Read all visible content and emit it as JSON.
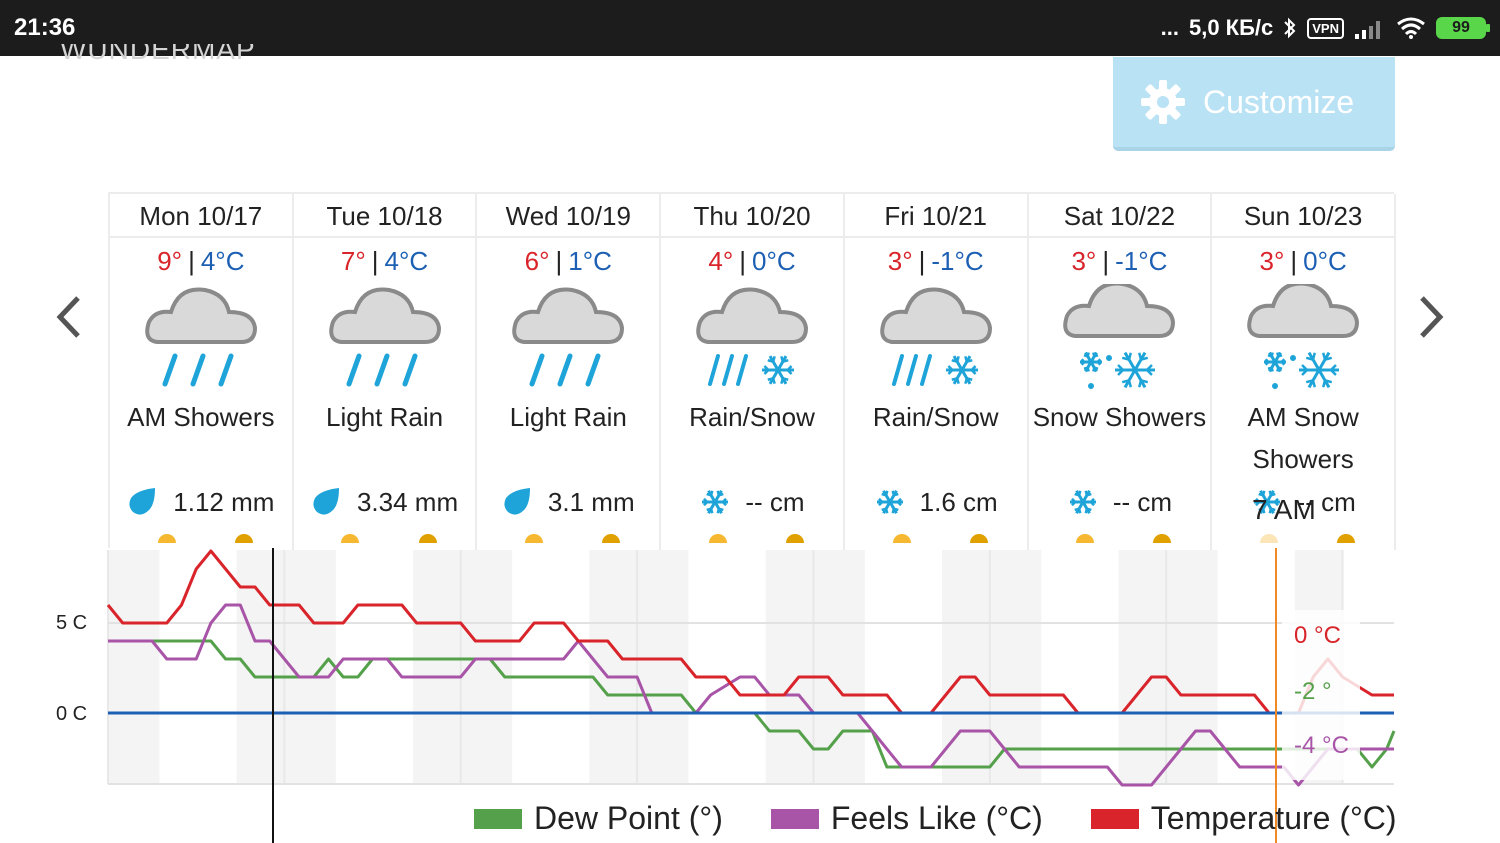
{
  "status_bar": {
    "time": "21:36",
    "dots": "...",
    "speed": "5,0 КБ/с",
    "vpn": "VPN",
    "battery": "99"
  },
  "header": {
    "wundermap": "WUNDERMAP",
    "customize_label": "Customize"
  },
  "days": [
    {
      "date": "Mon 10/17",
      "hi": "9°",
      "lo": "4°C",
      "icon": "rain-icon",
      "condition": "AM Showers",
      "precip_icon": "raindrop-icon",
      "precip": "1.12 mm"
    },
    {
      "date": "Tue 10/18",
      "hi": "7°",
      "lo": "4°C",
      "icon": "rain-icon",
      "condition": "Light Rain",
      "precip_icon": "raindrop-icon",
      "precip": "3.34 mm"
    },
    {
      "date": "Wed 10/19",
      "hi": "6°",
      "lo": "1°C",
      "icon": "rain-icon",
      "condition": "Light Rain",
      "precip_icon": "raindrop-icon",
      "precip": "3.1 mm"
    },
    {
      "date": "Thu 10/20",
      "hi": "4°",
      "lo": "0°C",
      "icon": "rain-snow-icon",
      "condition": "Rain/Snow",
      "precip_icon": "snowflake-icon",
      "precip": "-- cm"
    },
    {
      "date": "Fri 10/21",
      "hi": "3°",
      "lo": "-1°C",
      "icon": "rain-snow-icon",
      "condition": "Rain/Snow",
      "precip_icon": "snowflake-icon",
      "precip": "1.6 cm"
    },
    {
      "date": "Sat 10/22",
      "hi": "3°",
      "lo": "-1°C",
      "icon": "snow-showers-icon",
      "condition": "Snow Showers",
      "precip_icon": "snowflake-icon",
      "precip": "-- cm"
    },
    {
      "date": "Sun 10/23",
      "hi": "3°",
      "lo": "0°C",
      "icon": "snow-showers-icon",
      "condition": "AM Snow Showers",
      "precip_icon": "snowflake-icon",
      "precip": "-- cm"
    }
  ],
  "cursor_time": "7 AM",
  "colors": {
    "temperature": "#d8242a",
    "feels_like": "#a855a8",
    "dew_point": "#55a04a",
    "freezing_line": "#1c5fb3",
    "sunrise": "#f5b830",
    "sunset": "#e0a000"
  },
  "chart_data": {
    "type": "line",
    "y_ticks": [
      "5 C",
      "0 C"
    ],
    "ylim": [
      -4,
      9
    ],
    "x_range_hours": [
      0,
      168
    ],
    "tooltip": {
      "temperature": "0 °C",
      "dew_point": "-2 °",
      "feels_like": "-4 °C"
    },
    "series": [
      {
        "name": "Temperature (°C)",
        "points": [
          [
            0,
            6
          ],
          [
            2,
            5
          ],
          [
            8,
            5
          ],
          [
            10,
            6
          ],
          [
            12,
            8
          ],
          [
            14,
            9
          ],
          [
            16,
            8
          ],
          [
            18,
            7
          ],
          [
            20,
            7
          ],
          [
            22,
            6
          ],
          [
            26,
            6
          ],
          [
            28,
            5
          ],
          [
            32,
            5
          ],
          [
            34,
            6
          ],
          [
            40,
            6
          ],
          [
            42,
            5
          ],
          [
            48,
            5
          ],
          [
            50,
            4
          ],
          [
            56,
            4
          ],
          [
            58,
            5
          ],
          [
            62,
            5
          ],
          [
            64,
            4
          ],
          [
            68,
            4
          ],
          [
            70,
            3
          ],
          [
            78,
            3
          ],
          [
            80,
            2
          ],
          [
            84,
            2
          ],
          [
            86,
            1
          ],
          [
            92,
            1
          ],
          [
            94,
            2
          ],
          [
            98,
            2
          ],
          [
            100,
            1
          ],
          [
            106,
            1
          ],
          [
            108,
            0
          ],
          [
            112,
            0
          ],
          [
            114,
            1
          ],
          [
            116,
            2
          ],
          [
            118,
            2
          ],
          [
            120,
            1
          ],
          [
            130,
            1
          ],
          [
            132,
            0
          ],
          [
            138,
            0
          ],
          [
            140,
            1
          ],
          [
            142,
            2
          ],
          [
            144,
            2
          ],
          [
            146,
            1
          ],
          [
            156,
            1
          ],
          [
            158,
            0
          ],
          [
            162,
            0
          ],
          [
            164,
            2
          ],
          [
            166,
            3
          ],
          [
            168,
            2
          ],
          [
            172,
            1
          ],
          [
            175,
            1
          ]
        ]
      },
      {
        "name": "Feels Like (°C)",
        "points": [
          [
            0,
            4
          ],
          [
            6,
            4
          ],
          [
            8,
            3
          ],
          [
            12,
            3
          ],
          [
            14,
            5
          ],
          [
            16,
            6
          ],
          [
            18,
            6
          ],
          [
            20,
            4
          ],
          [
            22,
            4
          ],
          [
            24,
            3
          ],
          [
            26,
            2
          ],
          [
            30,
            2
          ],
          [
            32,
            3
          ],
          [
            38,
            3
          ],
          [
            40,
            2
          ],
          [
            48,
            2
          ],
          [
            50,
            3
          ],
          [
            62,
            3
          ],
          [
            64,
            4
          ],
          [
            66,
            3
          ],
          [
            68,
            2
          ],
          [
            72,
            2
          ],
          [
            74,
            0
          ],
          [
            80,
            0
          ],
          [
            82,
            1
          ],
          [
            86,
            2
          ],
          [
            88,
            2
          ],
          [
            90,
            1
          ],
          [
            94,
            1
          ],
          [
            96,
            0
          ],
          [
            102,
            0
          ],
          [
            104,
            -1
          ],
          [
            106,
            -2
          ],
          [
            108,
            -3
          ],
          [
            112,
            -3
          ],
          [
            114,
            -2
          ],
          [
            116,
            -1
          ],
          [
            120,
            -1
          ],
          [
            122,
            -2
          ],
          [
            124,
            -3
          ],
          [
            136,
            -3
          ],
          [
            138,
            -4
          ],
          [
            142,
            -4
          ],
          [
            144,
            -3
          ],
          [
            146,
            -2
          ],
          [
            148,
            -1
          ],
          [
            150,
            -1
          ],
          [
            152,
            -2
          ],
          [
            154,
            -3
          ],
          [
            160,
            -3
          ],
          [
            162,
            -4
          ],
          [
            164,
            -3
          ],
          [
            166,
            -2
          ],
          [
            175,
            -2
          ]
        ]
      },
      {
        "name": "Dew Point (°)",
        "points": [
          [
            0,
            4
          ],
          [
            14,
            4
          ],
          [
            16,
            3
          ],
          [
            18,
            3
          ],
          [
            20,
            2
          ],
          [
            28,
            2
          ],
          [
            30,
            3
          ],
          [
            32,
            2
          ],
          [
            34,
            2
          ],
          [
            36,
            3
          ],
          [
            52,
            3
          ],
          [
            54,
            2
          ],
          [
            66,
            2
          ],
          [
            68,
            1
          ],
          [
            78,
            1
          ],
          [
            80,
            0
          ],
          [
            88,
            0
          ],
          [
            90,
            -1
          ],
          [
            94,
            -1
          ],
          [
            96,
            -2
          ],
          [
            98,
            -2
          ],
          [
            100,
            -1
          ],
          [
            104,
            -1
          ],
          [
            106,
            -3
          ],
          [
            120,
            -3
          ],
          [
            122,
            -2
          ],
          [
            160,
            -2
          ],
          [
            166,
            -2
          ],
          [
            170,
            -2
          ],
          [
            172,
            -3
          ],
          [
            174,
            -2
          ],
          [
            175,
            -1
          ]
        ]
      }
    ]
  }
}
